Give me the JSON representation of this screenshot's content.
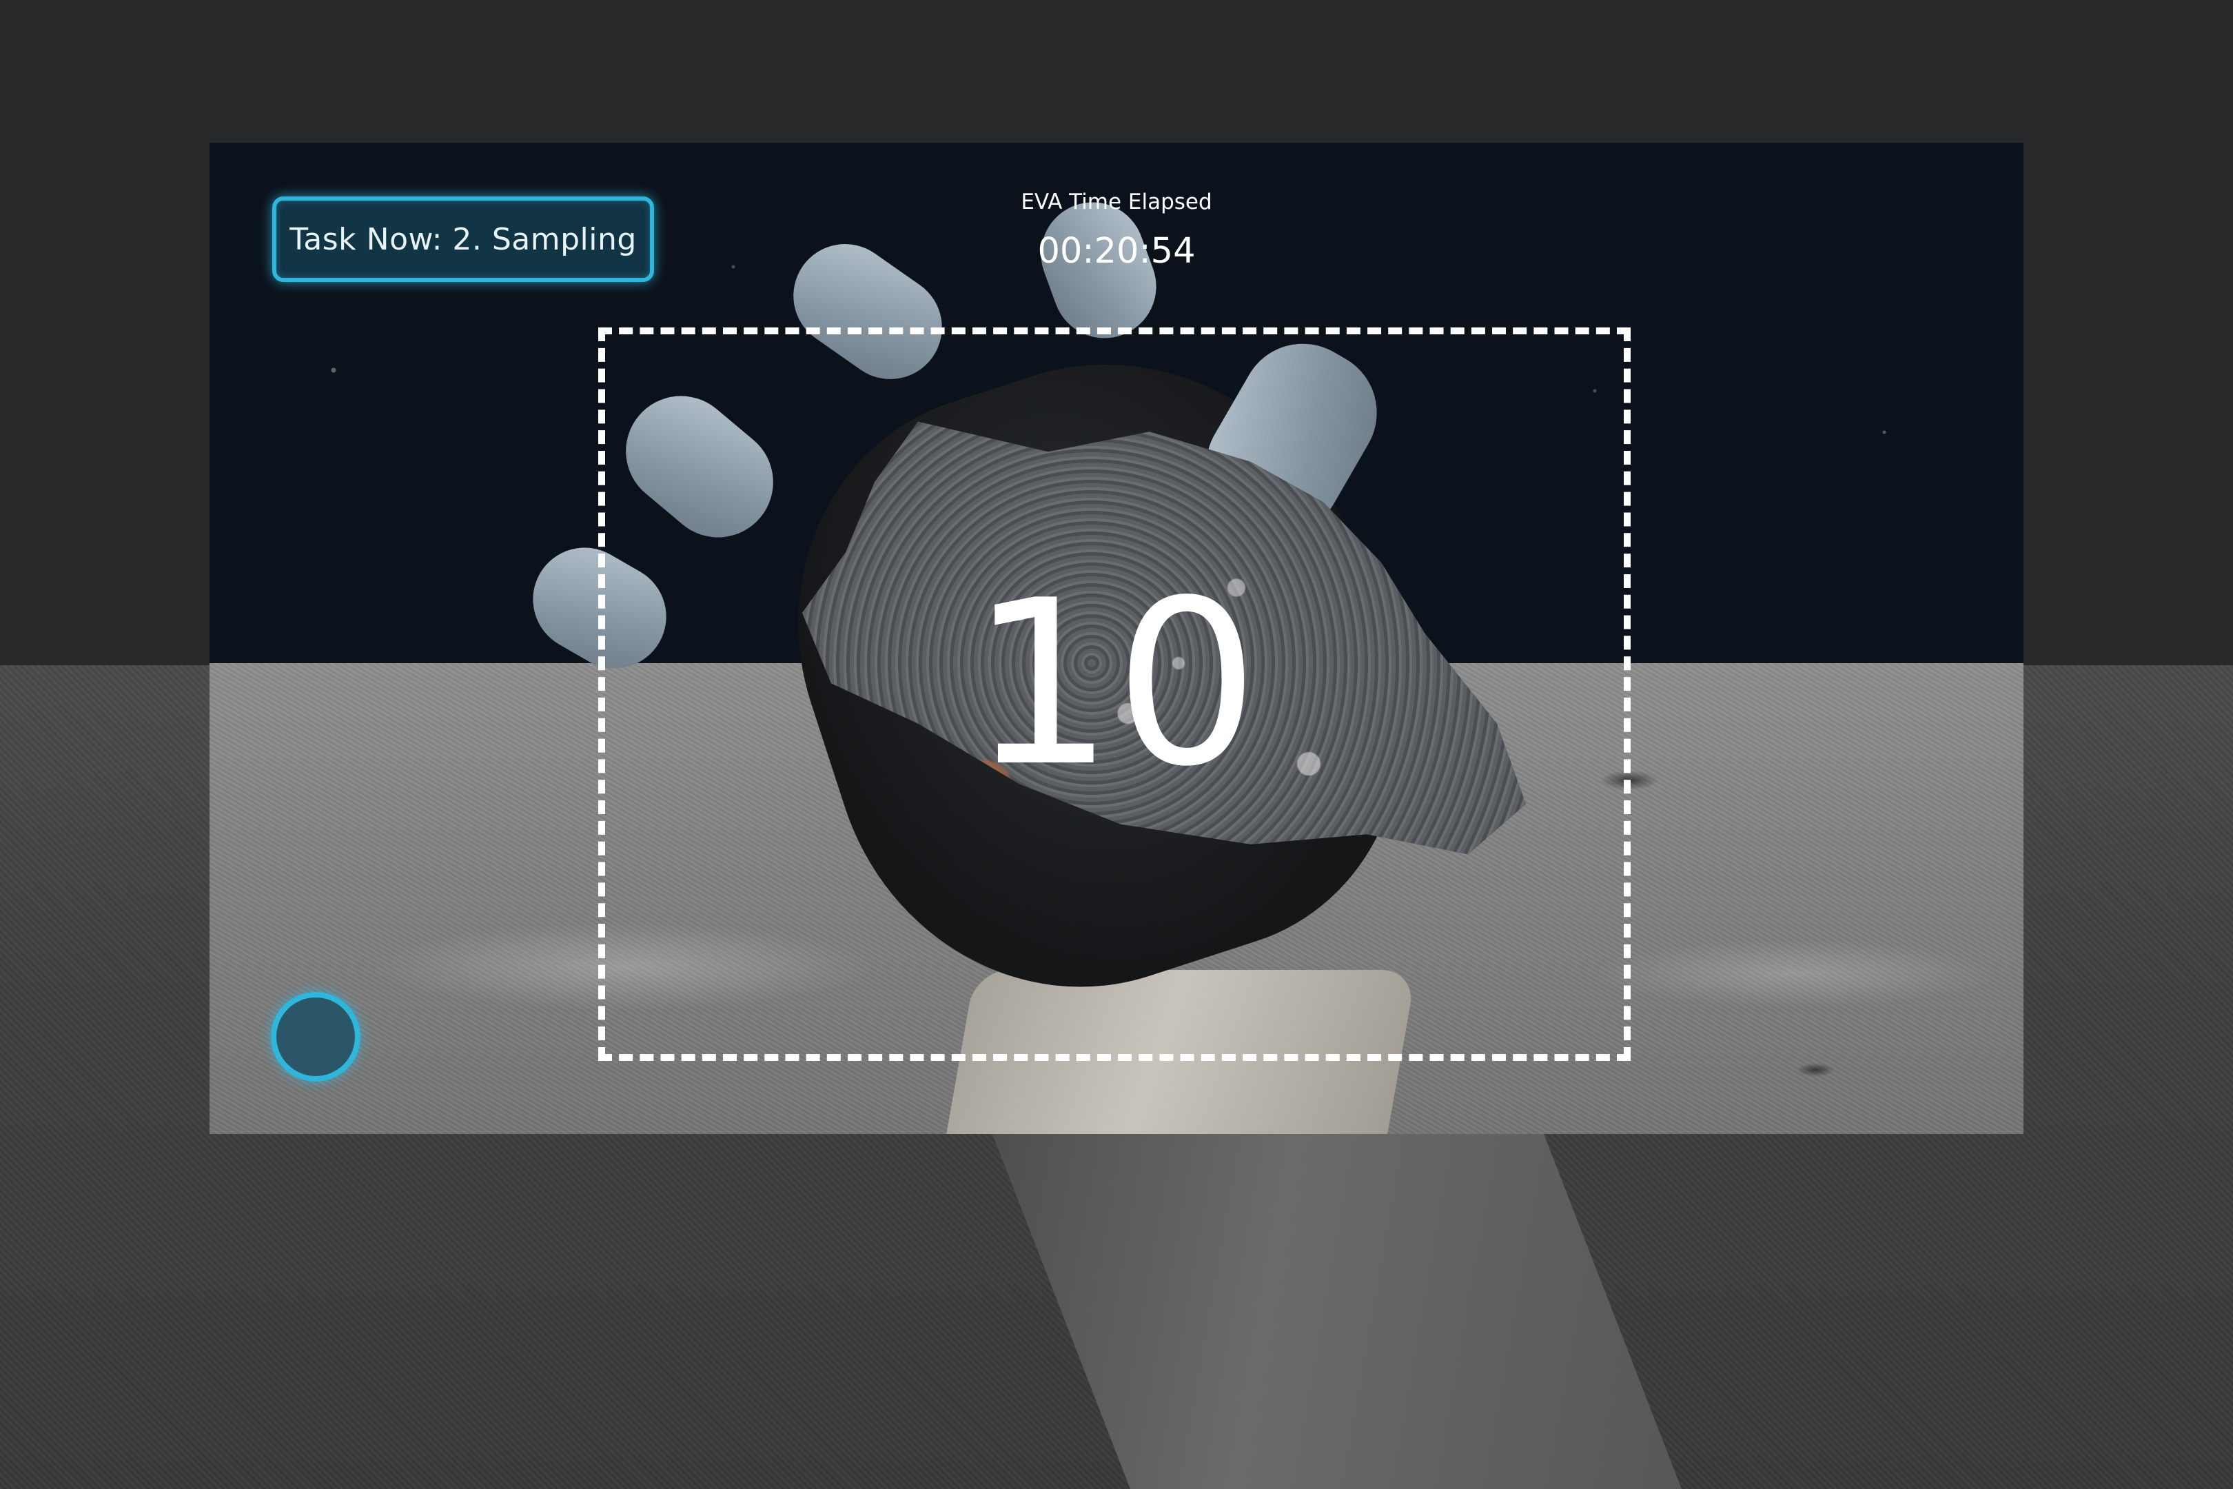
{
  "hud": {
    "task": {
      "label": "Task Now: 2. Sampling"
    },
    "timer": {
      "title": "EVA Time Elapsed",
      "value": "00:20:54"
    },
    "scan": {
      "countdown": "10"
    },
    "record_button": {
      "icon": "record-circle-icon"
    }
  },
  "colors": {
    "accent": "#2eb6dc",
    "frame": "#ffffff",
    "sky": "#0b121b",
    "backdrop": "#27282a"
  }
}
